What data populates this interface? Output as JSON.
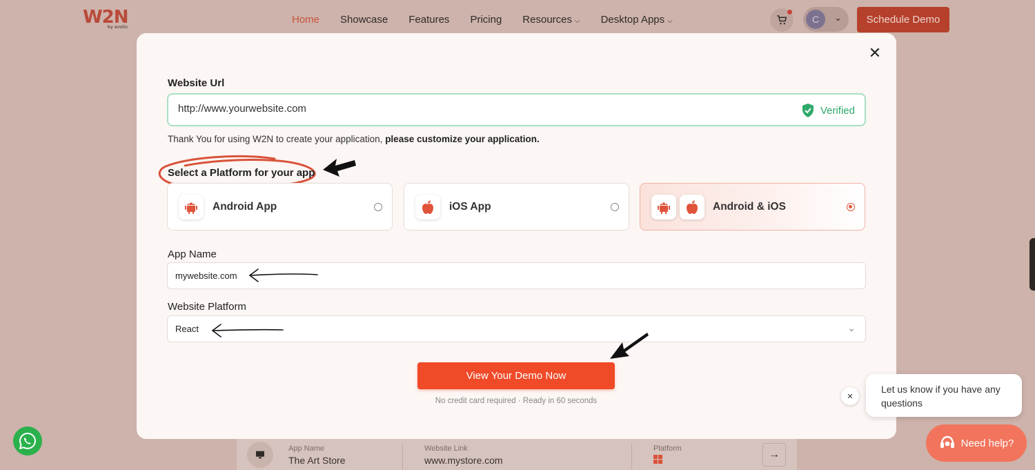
{
  "background_page": {
    "logo": {
      "text": "W2N",
      "sub": "by erotic"
    },
    "nav": {
      "items": [
        {
          "label": "Home"
        },
        {
          "label": "Showcase"
        },
        {
          "label": "Features"
        },
        {
          "label": "Pricing"
        },
        {
          "label": "Resources"
        },
        {
          "label": "Desktop Apps"
        }
      ],
      "active": "Home"
    },
    "avatar_initial": "C",
    "schedule_label": "Schedule Demo",
    "bottom_card": {
      "app_name_label": "App Name",
      "app_name_value": "The Art Store",
      "website_link_label": "Website Link",
      "website_link_value": "www.mystore.com",
      "platform_label": "Platform"
    }
  },
  "modal": {
    "website_url_label": "Website Url",
    "website_url_value": "http://www.yourwebsite.com",
    "verified_label": "Verified",
    "thanks_text": "Thank You for using W2N to create your application, ",
    "thanks_bold": "please customize your application.",
    "platform_section_label": "Select a Platform for your app",
    "platforms": [
      {
        "label": "Android App",
        "selected": false
      },
      {
        "label": "iOS App",
        "selected": false
      },
      {
        "label": "Android & iOS",
        "selected": true
      }
    ],
    "app_name_label": "App Name",
    "app_name_value": "mywebsite.com",
    "website_platform_label": "Website Platform",
    "website_platform_value": "React",
    "demo_button_label": "View Your Demo Now",
    "demo_note": "No credit card required · Ready in 60 seconds"
  },
  "chat": {
    "bubble_text": "Let us know if you have any questions",
    "help_label": "Need help?"
  },
  "colors": {
    "accent": "#f04a28",
    "verified_green": "#2ea96a",
    "android_icon": "#e0533a",
    "whatsapp": "#2bb14c"
  }
}
